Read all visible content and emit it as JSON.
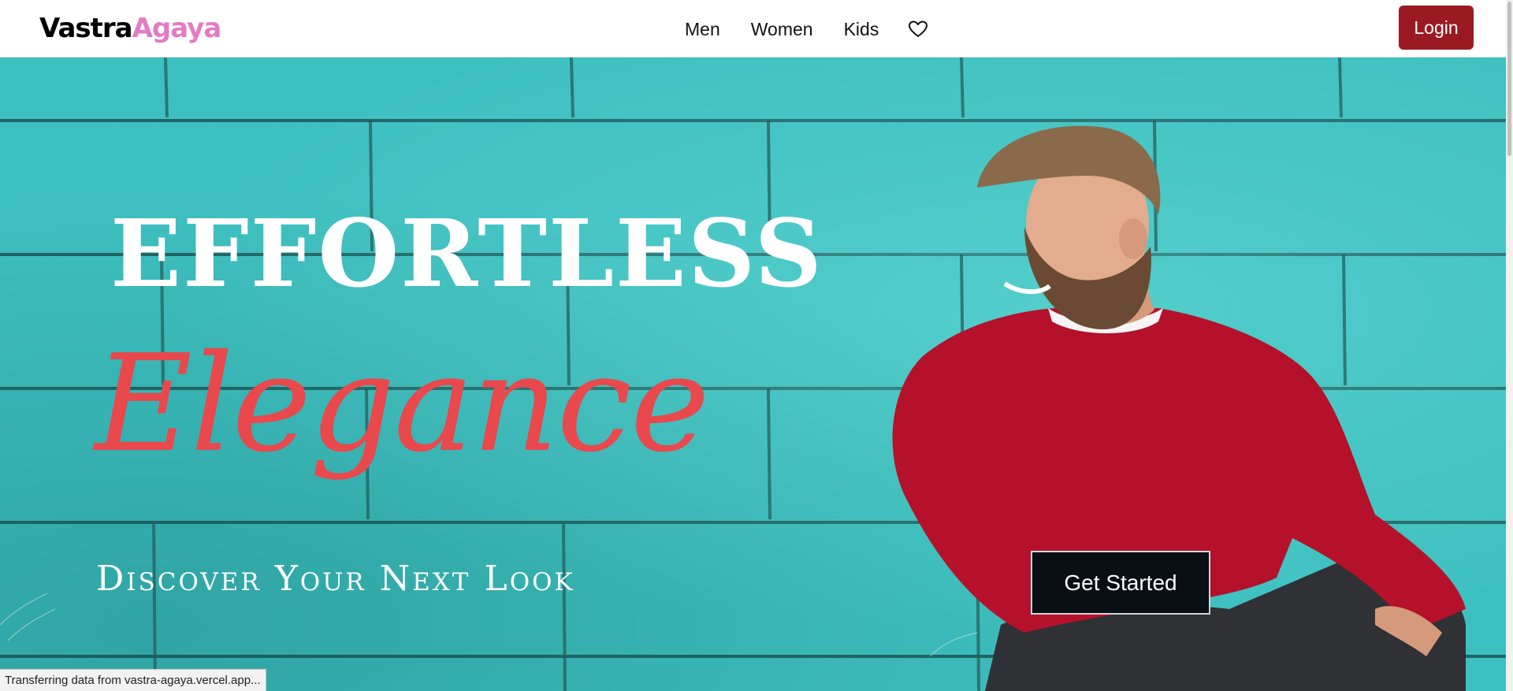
{
  "navbar": {
    "brand_part1": "Vastra",
    "brand_part2": "Agaya",
    "brand_color_1": "#000000",
    "brand_color_2": "#e57ac4",
    "links": [
      {
        "label": "Men"
      },
      {
        "label": "Women"
      },
      {
        "label": "Kids"
      }
    ],
    "wishlist_icon": "heart-outline-icon",
    "login_label": "Login",
    "login_color": "#9b1a22"
  },
  "hero": {
    "headline_1": "EFFORTLESS",
    "headline_2": "Elegance",
    "headline_2_color": "#e9484c",
    "tagline": "Discover Your Next Look",
    "cta_label": "Get Started",
    "background_color": "#3fc0c0",
    "image_subject": "smiling man in red sweater sitting against turquoise brick wall"
  },
  "status_bar": {
    "text": "Transferring data from vastra-agaya.vercel.app..."
  }
}
